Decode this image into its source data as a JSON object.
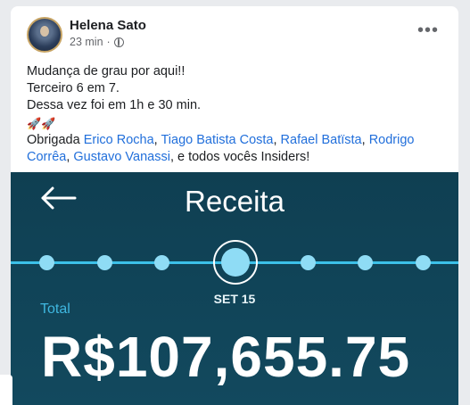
{
  "post": {
    "author": "Helena Sato",
    "time": "23 min",
    "separator": "·",
    "more_icon": "more-horizontal-icon",
    "lines": [
      "Mudança de grau por aqui!!",
      "Terceiro 6 em 7.",
      "Dessa vez foi em 1h e 30 min."
    ],
    "emoji": "🚀🚀",
    "thanks_prefix": "Obrigada",
    "mentions": [
      "Erico Rocha",
      "Tiago Batista Costa",
      "Rafael Batïsta",
      "Rodrigo Corrêa",
      "Gustavo Vanassi"
    ],
    "comma": ",",
    "and": "e",
    "thanks_suffix": ", e todos vocês Insiders!"
  },
  "app": {
    "title": "Receita",
    "selected_date": "SET 15",
    "total_label": "Total",
    "amount": "R$107,655.75",
    "colors": {
      "background": "#0f3f52",
      "accent": "#3fb7e0",
      "dot": "#8fdcf5"
    }
  }
}
